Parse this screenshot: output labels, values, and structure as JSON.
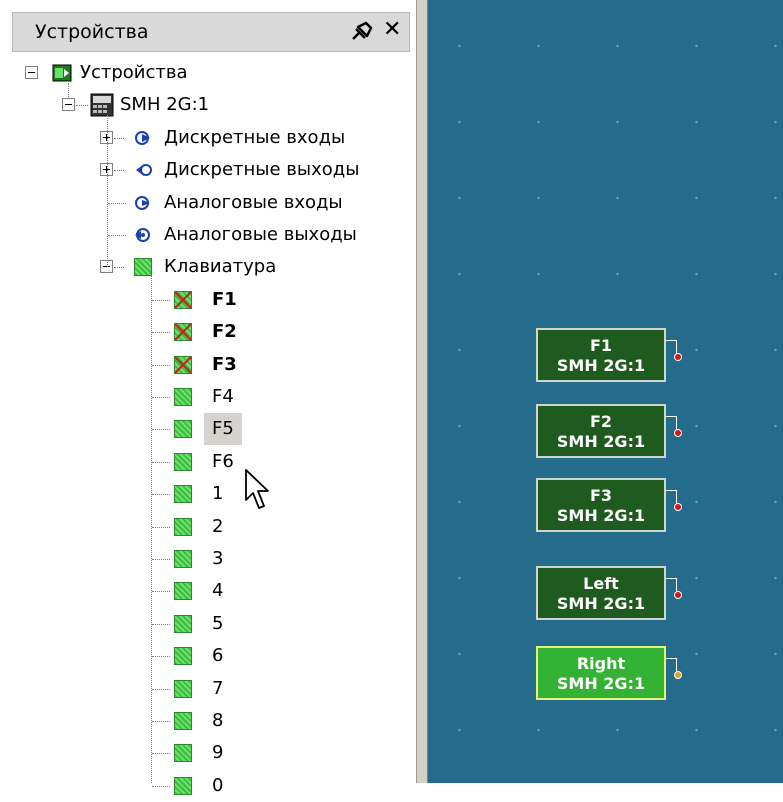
{
  "panel": {
    "title": "Устройства",
    "pin_icon": "pin-icon",
    "close_icon": "close-icon",
    "close_glyph": "✕"
  },
  "tree": {
    "root": {
      "label": "Устройства",
      "icon": "devices-icon"
    },
    "device": {
      "label": "SMH 2G:1",
      "icon": "device-panel-icon"
    },
    "groups": [
      {
        "label": "Дискретные входы",
        "icon": "digital-input-icon",
        "expandable": true
      },
      {
        "label": "Дискретные выходы",
        "icon": "digital-output-icon",
        "expandable": true
      },
      {
        "label": "Аналоговые входы",
        "icon": "analog-input-icon",
        "expandable": false
      },
      {
        "label": "Аналоговые выходы",
        "icon": "analog-output-icon",
        "expandable": false
      },
      {
        "label": "Клавиатура",
        "icon": "keyboard-icon",
        "expandable": true
      }
    ],
    "keys": [
      {
        "label": "F1",
        "bold": true,
        "used": true
      },
      {
        "label": "F2",
        "bold": true,
        "used": true
      },
      {
        "label": "F3",
        "bold": true,
        "used": true
      },
      {
        "label": "F4",
        "bold": false,
        "used": false
      },
      {
        "label": "F5",
        "bold": false,
        "used": false,
        "selected": true
      },
      {
        "label": "F6",
        "bold": false,
        "used": false
      },
      {
        "label": "1",
        "bold": false,
        "used": false
      },
      {
        "label": "2",
        "bold": false,
        "used": false
      },
      {
        "label": "3",
        "bold": false,
        "used": false
      },
      {
        "label": "4",
        "bold": false,
        "used": false
      },
      {
        "label": "5",
        "bold": false,
        "used": false
      },
      {
        "label": "6",
        "bold": false,
        "used": false
      },
      {
        "label": "7",
        "bold": false,
        "used": false
      },
      {
        "label": "8",
        "bold": false,
        "used": false
      },
      {
        "label": "9",
        "bold": false,
        "used": false
      },
      {
        "label": "0",
        "bold": false,
        "used": false
      }
    ]
  },
  "canvas": {
    "background_color": "#256b8c",
    "blocks": [
      {
        "name": "F1",
        "device": "SMH 2G:1",
        "active": false
      },
      {
        "name": "F2",
        "device": "SMH 2G:1",
        "active": false
      },
      {
        "name": "F3",
        "device": "SMH 2G:1",
        "active": false
      },
      {
        "name": "Left",
        "device": "SMH 2G:1",
        "active": false
      },
      {
        "name": "Right",
        "device": "SMH 2G:1",
        "active": true
      }
    ]
  },
  "colors": {
    "block_bg": "#1f5a1f",
    "block_active_bg": "#33b233",
    "port_dot": "#d11818",
    "port_dot_active": "#e6a020"
  }
}
